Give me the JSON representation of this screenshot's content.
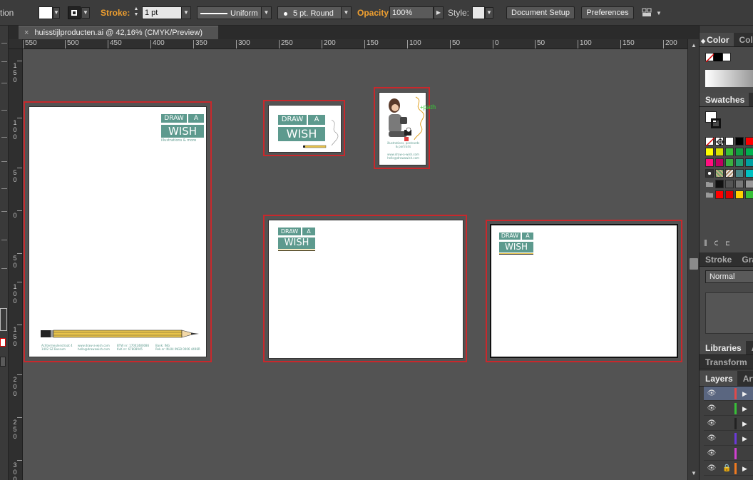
{
  "control_bar": {
    "tool_label": "tion",
    "stroke_label": "Stroke:",
    "stroke_weight": "1 pt",
    "stroke_profile": "Uniform",
    "brush": "5 pt. Round",
    "opacity_label": "Opacity:",
    "opacity_value": "100%",
    "style_label": "Style:",
    "document_setup": "Document Setup",
    "preferences": "Preferences"
  },
  "document": {
    "tab_title": "huisstijlproducten.ai @ 42,16% (CMYK/Preview)",
    "close_glyph": "×"
  },
  "rulers": {
    "horizontal": [
      "550",
      "500",
      "450",
      "400",
      "350",
      "300",
      "250",
      "200",
      "150",
      "100",
      "50",
      "0",
      "50",
      "100",
      "150",
      "200"
    ],
    "vertical": [
      "150",
      "100",
      "50",
      "0",
      "50",
      "100",
      "150",
      "200",
      "250",
      "300"
    ]
  },
  "artboards": {
    "logo": {
      "line1a": "DRAW",
      "line1b": "A",
      "line2": "WISH",
      "tagline": "illustrations & more"
    },
    "letterhead_footer": {
      "col1": "Achtermeulenstraat 4\n1402 SZ Bussum",
      "col2": "www.draw-a-wish.com\nhello@drawawish.com",
      "col3": "BTW nr: 17002480086\nKvK nr: 67808945",
      "col4": "Bank: ING\nRek.nr: NL04 INGB 0006 4498R"
    },
    "card_back": {
      "caption": "illustrations, postcards\n& portraits",
      "contact": "www.draw-a-wish.com\nhello@drawawish.com",
      "path_label": "path"
    }
  },
  "panels": {
    "color_tabs": [
      "Color",
      "Colo"
    ],
    "swatches_tabs": [
      "Swatches",
      "B"
    ],
    "stroke_tabs": [
      "Stroke",
      "Grad"
    ],
    "blend_mode": "Normal",
    "libraries_tabs": [
      "Libraries",
      "Ap"
    ],
    "transform_tab": "Transform",
    "layers_tabs": [
      "Layers",
      "Artb"
    ],
    "layer_colors": [
      "#e04a4a",
      "#38c038",
      "#222222",
      "#6a3ad8",
      "#d040d0",
      "#f07a20"
    ]
  },
  "colors": {
    "teal": "#5d9a8e",
    "artboard_border": "#c8282c",
    "canvas": "#535353"
  }
}
